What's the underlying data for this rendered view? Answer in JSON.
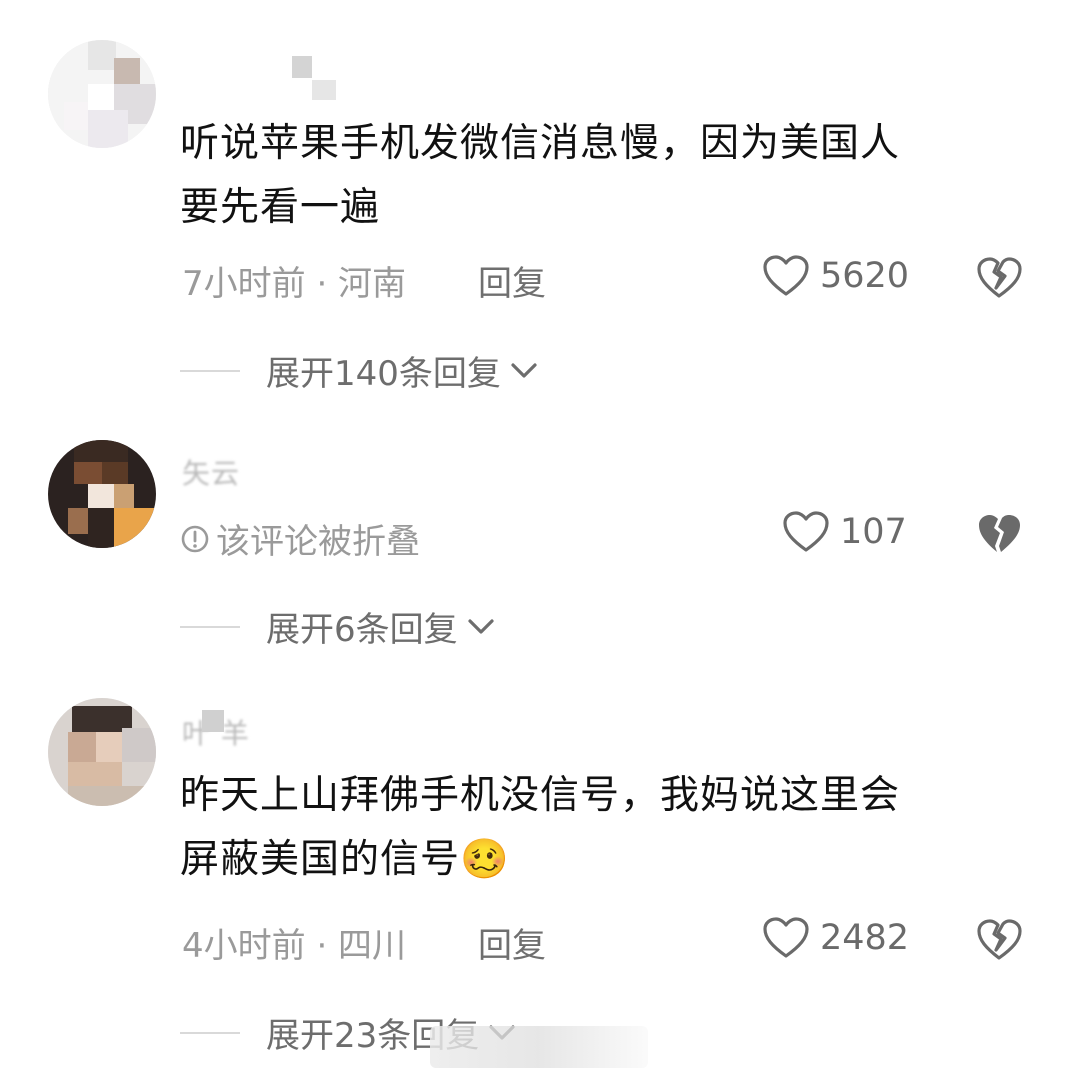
{
  "comments": [
    {
      "text_line1": "听说苹果手机发微信消息慢，因为美国人",
      "text_line2": "要先看一遍",
      "time_location": "7小时前 · 河南",
      "reply_label": "回复",
      "likes": "5620",
      "expand_label": "展开140条回复"
    },
    {
      "username": "矢云",
      "folded_notice": "该评论被折叠",
      "likes": "107",
      "expand_label": "展开6条回复"
    },
    {
      "username": "叶  羊",
      "text_line1": "昨天上山拜佛手机没信号，我妈说这里会",
      "text_line2": "屏蔽美国的信号",
      "emoji": "🥴",
      "time_location": "4小时前 · 四川",
      "reply_label": "回复",
      "likes": "2482",
      "expand_label": "展开23条回复"
    }
  ],
  "colors": {
    "text_primary": "#111111",
    "text_secondary": "#9a9a9a",
    "icon": "#6a6a6a",
    "background": "#ffffff"
  },
  "icons": {
    "like": "heart-outline-icon",
    "dislike": "broken-heart-icon",
    "expand": "chevron-down-icon",
    "folded": "info-circle-icon"
  }
}
